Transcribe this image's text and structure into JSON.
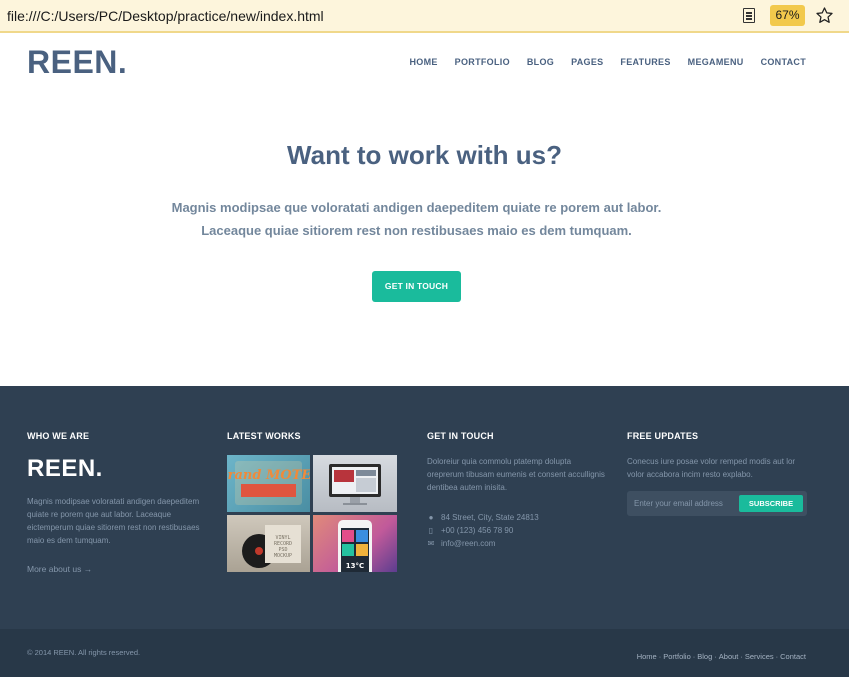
{
  "browser": {
    "url": "file:///C:/Users/PC/Desktop/practice/new/index.html",
    "zoom": "67%"
  },
  "header": {
    "logo": "REEN.",
    "nav": [
      "HOME",
      "PORTFOLIO",
      "BLOG",
      "PAGES",
      "FEATURES",
      "MEGAMENU",
      "CONTACT"
    ]
  },
  "hero": {
    "title": "Want to work with us?",
    "line1": "Magnis modipsae que voloratati andigen daepeditem quiate re porem aut labor.",
    "line2": "Laceaque quiae sitiorem rest non restibusaes maio es dem tumquam.",
    "button": "GET IN TOUCH"
  },
  "footer": {
    "who": {
      "heading": "WHO WE ARE",
      "logo": "REEN.",
      "text": "Magnis modipsae voloratati andigen daepeditem quiate re porem que aut labor. Laceaque eictemperum quiae sitiorem rest non restibusaes maio es dem tumquam.",
      "link": "More about us →"
    },
    "works": {
      "heading": "LATEST WORKS",
      "items": [
        {
          "label": "Grand MOTEL"
        },
        {
          "label": ""
        },
        {
          "label": "VINYL RECORD PSD MOCKUP"
        },
        {
          "label": "13°C"
        }
      ]
    },
    "contact": {
      "heading": "GET IN TOUCH",
      "text": "Doloreiur quia commolu ptatemp dolupta oreprerum tibusam eumenis et consent accullignis dentibea autem inisita.",
      "address": "84 Street, City, State 24813",
      "phone": "+00 (123) 456 78 90",
      "email": "info@reen.com"
    },
    "updates": {
      "heading": "FREE UPDATES",
      "text": "Conecus iure posae volor remped modis aut lor volor accabora incim resto explabo.",
      "placeholder": "Enter your email address",
      "button": "SUBSCRIBE"
    }
  },
  "bottom": {
    "copyright": "© 2014 REEN. All rights reserved.",
    "links": [
      "Home",
      "Portfolio",
      "Blog",
      "About",
      "Services",
      "Contact"
    ]
  }
}
